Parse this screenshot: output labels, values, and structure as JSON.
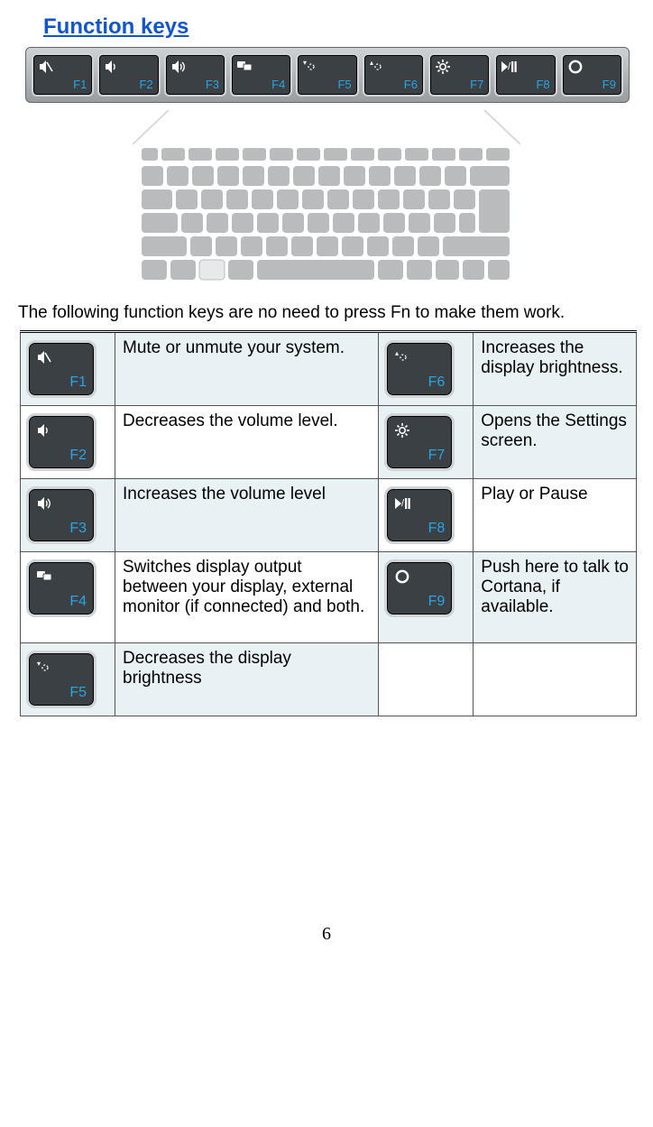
{
  "heading": "Function keys",
  "intro": "The following function keys are no need to press Fn to make them work.",
  "page_number": "6",
  "keys": {
    "f1": {
      "label": "F1",
      "icon": "mute-icon",
      "desc": "Mute or unmute your system."
    },
    "f2": {
      "label": "F2",
      "icon": "volume-down-icon",
      "desc": "Decreases the volume level."
    },
    "f3": {
      "label": "F3",
      "icon": "volume-up-icon",
      "desc": "Increases the volume level"
    },
    "f4": {
      "label": "F4",
      "icon": "display-switch-icon",
      "desc": "Switches display output between your display, external monitor (if connected) and both."
    },
    "f5": {
      "label": "F5",
      "icon": "brightness-down-icon",
      "desc": "Decreases the display brightness"
    },
    "f6": {
      "label": "F6",
      "icon": "brightness-up-icon",
      "desc": "Increases the display brightness."
    },
    "f7": {
      "label": "F7",
      "icon": "settings-icon",
      "desc": "Opens the Settings screen."
    },
    "f8": {
      "label": "F8",
      "icon": "play-pause-icon",
      "desc": "Play or Pause"
    },
    "f9": {
      "label": "F9",
      "icon": "cortana-icon",
      "desc": "Push here to talk to Cortana, if available."
    }
  }
}
